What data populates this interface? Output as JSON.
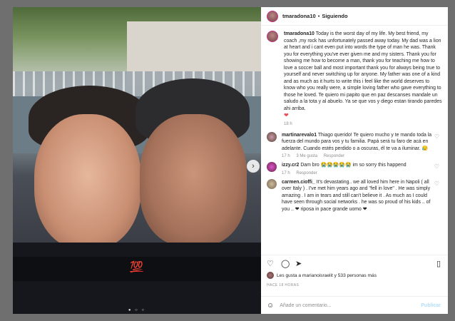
{
  "header": {
    "username": "tmaradona10",
    "separator": "•",
    "follow_label": "Siguiendo"
  },
  "post": {
    "username": "tmaradona10",
    "text": "Today is the worst day of my life. My best friend, my coach ,my rock has unfortunately passed away today. My dad was a lion at heart and i cant even put into words the type of man he was. Thank you for everything you've ever given me and my sisters. Thank you for showing me how to become a man, thank you for teaching me how to love a soccer ball and most important thank you for always being true to yourself and never switching up for anyone. My father was one of a kind and as much as it hurts to write this i feel like the world deserves to know who you really were, a simple loving father who gave everything to those he loved. Te quiero mi papito que en paz descanses mandale un saludo a la tota y al abuelo. Ya se que vos y diego estan tirando paredes ahi arriba.",
    "heart": "❤",
    "time": "18 h"
  },
  "comments": [
    {
      "username": "martinarevalo1",
      "text": "Thiago querido! Te quiero mucho y te mando toda la fuerza del mundo para vos y tu familia. Papá será tu faro de acá en adelante. Cuando estés perdido o a oscuras, él te va a iluminar. 😥",
      "time": "17 h",
      "likes": "3 Me gusta",
      "reply": "Responder"
    },
    {
      "username": "izzy.cr2",
      "text": "Dam bro 😭😭😭😭😭 im so sorry this happend",
      "time": "17 h",
      "likes": "",
      "reply": "Responder"
    },
    {
      "username": "carmen.cioffi_",
      "text": "It's devastating.. we all loved him here in Napoli ( all over Italy ) . I've met him years ago and \"fell in love\" . He was simply amazing . I am in tears and still can't believe it . As much as I could have seen through social networks . he was so proud of his kids .. of you .. ❤ riposa in pace grande uomo ❤",
      "time": "",
      "likes": "",
      "reply": ""
    }
  ],
  "likes_line": "Les gusta a marianoisraelit y 533 personas más",
  "when": "HACE 18 HORAS",
  "add_comment": {
    "placeholder": "Añade un comentario...",
    "publish": "Publicar"
  },
  "photo": {
    "emoji": "💯",
    "next": "›"
  },
  "icons": {
    "like": "heart-icon",
    "comment": "comment-icon",
    "share": "share-icon",
    "save": "bookmark-icon",
    "emoji": "smile-icon"
  }
}
